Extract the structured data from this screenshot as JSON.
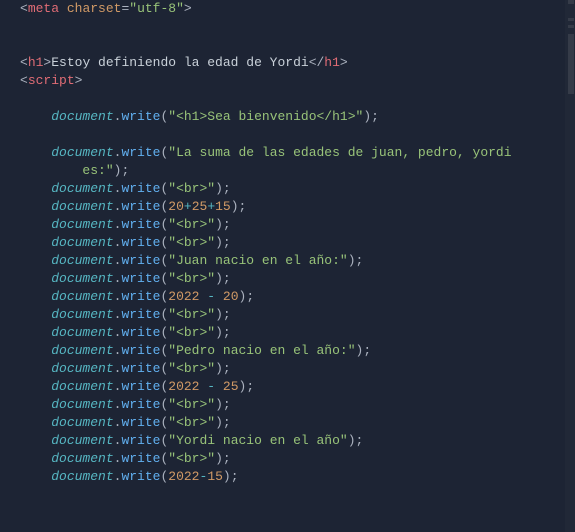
{
  "lines": [
    {
      "kind": "metatag",
      "parts": [
        "<",
        "meta",
        " ",
        "charset",
        "=",
        "\"utf-8\"",
        ">"
      ]
    },
    {
      "kind": "blank"
    },
    {
      "kind": "blank"
    },
    {
      "kind": "h1tag",
      "open": "<",
      "name": "h1",
      "gt": ">",
      "text": "Estoy definiendo la edad de Yordi",
      "copen": "</",
      "cname": "h1",
      "cgt": ">"
    },
    {
      "kind": "scriptopen",
      "open": "<",
      "name": "script",
      "gt": ">"
    },
    {
      "kind": "blank"
    },
    {
      "kind": "write_str",
      "indent": "    ",
      "obj": "document",
      "fn": "write",
      "str": "\"<h1>Sea bienvenido</h1>\""
    },
    {
      "kind": "blank"
    },
    {
      "kind": "write_str_wrap1",
      "indent": "    ",
      "obj": "document",
      "fn": "write",
      "str": "\"La suma de las edades de juan, pedro, yordi "
    },
    {
      "kind": "write_str_wrap2",
      "indent": "        ",
      "str": "es:\""
    },
    {
      "kind": "write_str",
      "indent": "    ",
      "obj": "document",
      "fn": "write",
      "str": "\"<br>\""
    },
    {
      "kind": "write_expr3",
      "indent": "    ",
      "obj": "document",
      "fn": "write",
      "a": "20",
      "op1": "+",
      "b": "25",
      "op2": "+",
      "c": "15"
    },
    {
      "kind": "write_str",
      "indent": "    ",
      "obj": "document",
      "fn": "write",
      "str": "\"<br>\""
    },
    {
      "kind": "write_str",
      "indent": "    ",
      "obj": "document",
      "fn": "write",
      "str": "\"<br>\""
    },
    {
      "kind": "write_str",
      "indent": "    ",
      "obj": "document",
      "fn": "write",
      "str": "\"Juan nacio en el año:\""
    },
    {
      "kind": "write_str",
      "indent": "    ",
      "obj": "document",
      "fn": "write",
      "str": "\"<br>\""
    },
    {
      "kind": "write_expr2",
      "indent": "    ",
      "obj": "document",
      "fn": "write",
      "a": "2022",
      "op": " - ",
      "b": "20"
    },
    {
      "kind": "write_str",
      "indent": "    ",
      "obj": "document",
      "fn": "write",
      "str": "\"<br>\""
    },
    {
      "kind": "write_str",
      "indent": "    ",
      "obj": "document",
      "fn": "write",
      "str": "\"<br>\""
    },
    {
      "kind": "write_str",
      "indent": "    ",
      "obj": "document",
      "fn": "write",
      "str": "\"Pedro nacio en el año:\""
    },
    {
      "kind": "write_str",
      "indent": "    ",
      "obj": "document",
      "fn": "write",
      "str": "\"<br>\""
    },
    {
      "kind": "write_expr2",
      "indent": "    ",
      "obj": "document",
      "fn": "write",
      "a": "2022",
      "op": " - ",
      "b": "25"
    },
    {
      "kind": "write_str",
      "indent": "    ",
      "obj": "document",
      "fn": "write",
      "str": "\"<br>\""
    },
    {
      "kind": "write_str",
      "indent": "    ",
      "obj": "document",
      "fn": "write",
      "str": "\"<br>\""
    },
    {
      "kind": "write_str",
      "indent": "    ",
      "obj": "document",
      "fn": "write",
      "str": "\"Yordi nacio en el año\""
    },
    {
      "kind": "write_str",
      "indent": "    ",
      "obj": "document",
      "fn": "write",
      "str": "\"<br>\""
    },
    {
      "kind": "write_expr2",
      "indent": "    ",
      "obj": "document",
      "fn": "write",
      "a": "2022",
      "op": "-",
      "b": "15"
    }
  ]
}
